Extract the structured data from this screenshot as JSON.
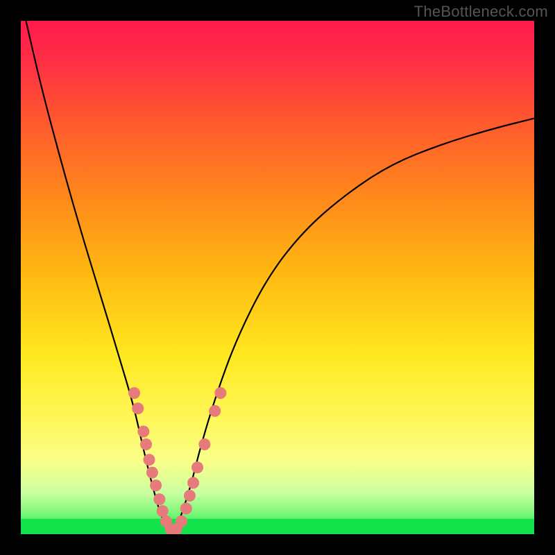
{
  "watermark": "TheBottleneck.com",
  "chart_data": {
    "type": "line",
    "title": "",
    "xlabel": "",
    "ylabel": "",
    "xlim": [
      0,
      100
    ],
    "ylim": [
      0,
      100
    ],
    "gradient": {
      "stops": [
        {
          "offset": 0.0,
          "color": "#ff1a4d"
        },
        {
          "offset": 0.08,
          "color": "#ff2f44"
        },
        {
          "offset": 0.2,
          "color": "#ff5a2d"
        },
        {
          "offset": 0.35,
          "color": "#ff8a1a"
        },
        {
          "offset": 0.5,
          "color": "#ffbb12"
        },
        {
          "offset": 0.65,
          "color": "#ffe81f"
        },
        {
          "offset": 0.78,
          "color": "#fff85b"
        },
        {
          "offset": 0.86,
          "color": "#f8ff8a"
        },
        {
          "offset": 0.92,
          "color": "#caffa0"
        },
        {
          "offset": 0.96,
          "color": "#79f777"
        },
        {
          "offset": 1.0,
          "color": "#14e24a"
        }
      ]
    },
    "green_band_top_y": 3,
    "series": [
      {
        "name": "bottleneck-curve",
        "x": [
          1,
          4,
          8,
          12,
          16,
          19,
          22,
          24,
          26,
          27.5,
          29,
          30,
          31,
          33,
          35,
          38,
          42,
          48,
          55,
          63,
          72,
          82,
          92,
          100
        ],
        "y": [
          100,
          87,
          72,
          58,
          45,
          35,
          25,
          16,
          8,
          3,
          0.5,
          0.5,
          3,
          9,
          17,
          27,
          38,
          50,
          59,
          66,
          72,
          76,
          79,
          81
        ]
      }
    ],
    "highlight_points": [
      {
        "x": 22.1,
        "y": 27.5
      },
      {
        "x": 22.8,
        "y": 24.5
      },
      {
        "x": 23.9,
        "y": 20.0
      },
      {
        "x": 24.4,
        "y": 17.5
      },
      {
        "x": 25.0,
        "y": 14.5
      },
      {
        "x": 25.6,
        "y": 12.0
      },
      {
        "x": 26.3,
        "y": 9.5
      },
      {
        "x": 27.0,
        "y": 6.8
      },
      {
        "x": 27.6,
        "y": 4.5
      },
      {
        "x": 28.3,
        "y": 2.5
      },
      {
        "x": 29.2,
        "y": 1.0
      },
      {
        "x": 30.3,
        "y": 1.0
      },
      {
        "x": 31.3,
        "y": 2.5
      },
      {
        "x": 32.2,
        "y": 5.0
      },
      {
        "x": 32.9,
        "y": 7.5
      },
      {
        "x": 33.6,
        "y": 10.0
      },
      {
        "x": 34.4,
        "y": 13.0
      },
      {
        "x": 35.8,
        "y": 17.5
      },
      {
        "x": 37.8,
        "y": 24.0
      },
      {
        "x": 38.9,
        "y": 27.5
      }
    ],
    "dot_radius": 1.15
  }
}
